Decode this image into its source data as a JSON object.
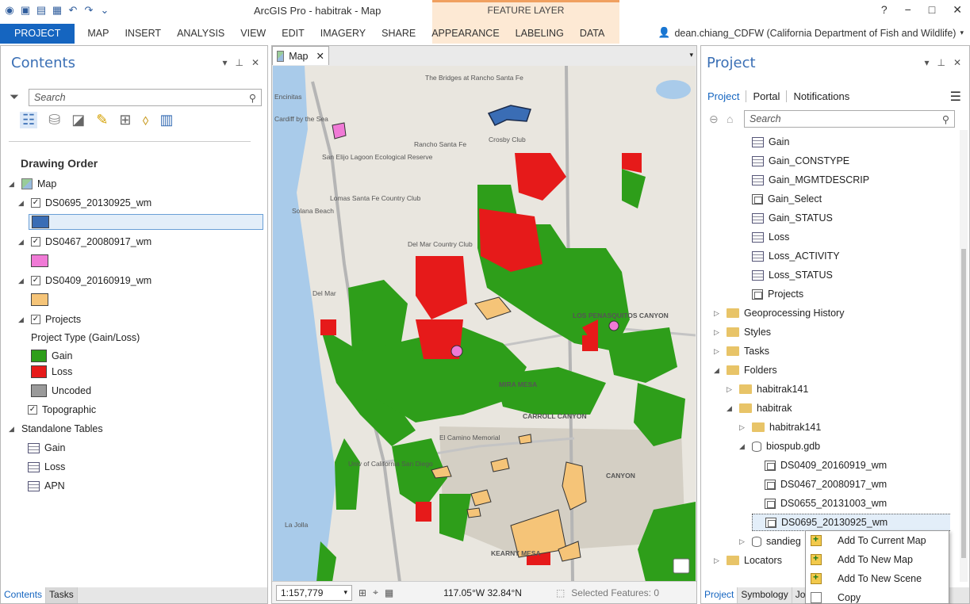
{
  "titlebar": {
    "title": "ArcGIS Pro - habitrak - Map",
    "context_band": "FEATURE LAYER",
    "help": "?",
    "minimize": "−",
    "restore": "□",
    "close": "✕"
  },
  "ribbon": {
    "tabs": [
      "PROJECT",
      "MAP",
      "INSERT",
      "ANALYSIS",
      "VIEW",
      "EDIT",
      "IMAGERY",
      "SHARE",
      "APPEARANCE",
      "LABELING",
      "DATA"
    ],
    "user": "dean.chiang_CDFW (California Department of Fish and Wildlife)"
  },
  "contents": {
    "title": "Contents",
    "search_placeholder": "Search",
    "section": "Drawing Order",
    "map": "Map",
    "layers": [
      {
        "name": "DS0695_20130925_wm",
        "color": "#3a6db5"
      },
      {
        "name": "DS0467_20080917_wm",
        "color": "#f07ad6"
      },
      {
        "name": "DS0409_20160919_wm",
        "color": "#f5c478"
      }
    ],
    "projects_layer": "Projects",
    "projects_field": "Project Type (Gain/Loss)",
    "classes": [
      {
        "label": "Gain",
        "color": "#2e9e1a"
      },
      {
        "label": "Loss",
        "color": "#e61a1a"
      },
      {
        "label": "Uncoded",
        "color": "#9a9a9a"
      }
    ],
    "basemap": "Topographic",
    "standalone_header": "Standalone Tables",
    "tables": [
      "Gain",
      "Loss",
      "APN"
    ],
    "bottom_tabs": [
      "Contents",
      "Tasks"
    ]
  },
  "map": {
    "tab_label": "Map",
    "scale": "1:157,779",
    "coords": "117.05°W 32.84°N",
    "selected": "Selected Features: 0",
    "labels": [
      "The Bridges at Rancho Santa Fe",
      "Rancho Santa Fe",
      "Crosby Club",
      "Cardiff by the Sea",
      "San Elijo Lagoon Ecological Reserve",
      "Solana Beach",
      "Lomas Santa Fe Country Club",
      "Del Mar Country Club",
      "Del Mar",
      "MIRA MESA",
      "CARROLL CANYON",
      "Univ of California San Diego",
      "La Jolla",
      "KEARNY MESA",
      "El Camino Memorial",
      "LOS PENASQUITOS CANYON",
      "CANYON",
      "Encinitas"
    ]
  },
  "project": {
    "title": "Project",
    "subtabs": [
      "Project",
      "Portal",
      "Notifications"
    ],
    "search_placeholder": "Search",
    "items": [
      {
        "label": "Gain",
        "indent": 3,
        "icon": "table"
      },
      {
        "label": "Gain_CONSTYPE",
        "indent": 3,
        "icon": "table"
      },
      {
        "label": "Gain_MGMTDESCRIP",
        "indent": 3,
        "icon": "table"
      },
      {
        "label": "Gain_Select",
        "indent": 3,
        "icon": "fc"
      },
      {
        "label": "Gain_STATUS",
        "indent": 3,
        "icon": "table"
      },
      {
        "label": "Loss",
        "indent": 3,
        "icon": "table"
      },
      {
        "label": "Loss_ACTIVITY",
        "indent": 3,
        "icon": "table"
      },
      {
        "label": "Loss_STATUS",
        "indent": 3,
        "icon": "table"
      },
      {
        "label": "Projects",
        "indent": 3,
        "icon": "fc"
      },
      {
        "label": "Geoprocessing History",
        "indent": 1,
        "icon": "folder"
      },
      {
        "label": "Styles",
        "indent": 1,
        "icon": "folder"
      },
      {
        "label": "Tasks",
        "indent": 1,
        "icon": "folder"
      },
      {
        "label": "Folders",
        "indent": 1,
        "icon": "folder"
      },
      {
        "label": "habitrak141",
        "indent": 2,
        "icon": "folder"
      },
      {
        "label": "habitrak",
        "indent": 2,
        "icon": "folder"
      },
      {
        "label": "habitrak141",
        "indent": 3,
        "icon": "folder"
      },
      {
        "label": "biospub.gdb",
        "indent": 3,
        "icon": "gdb"
      },
      {
        "label": "DS0409_20160919_wm",
        "indent": 4,
        "icon": "fc"
      },
      {
        "label": "DS0467_20080917_wm",
        "indent": 4,
        "icon": "fc"
      },
      {
        "label": "DS0655_20131003_wm",
        "indent": 4,
        "icon": "fc"
      },
      {
        "label": "DS0695_20130925_wm",
        "indent": 4,
        "icon": "fc"
      },
      {
        "label": "sandieg",
        "indent": 3,
        "icon": "gdb"
      },
      {
        "label": "Locators",
        "indent": 1,
        "icon": "folder"
      }
    ],
    "bottom_tabs": [
      "Project",
      "Symbology",
      "Job"
    ]
  },
  "context_menu": [
    "Add To Current Map",
    "Add To New Map",
    "Add To New Scene",
    "Copy"
  ]
}
